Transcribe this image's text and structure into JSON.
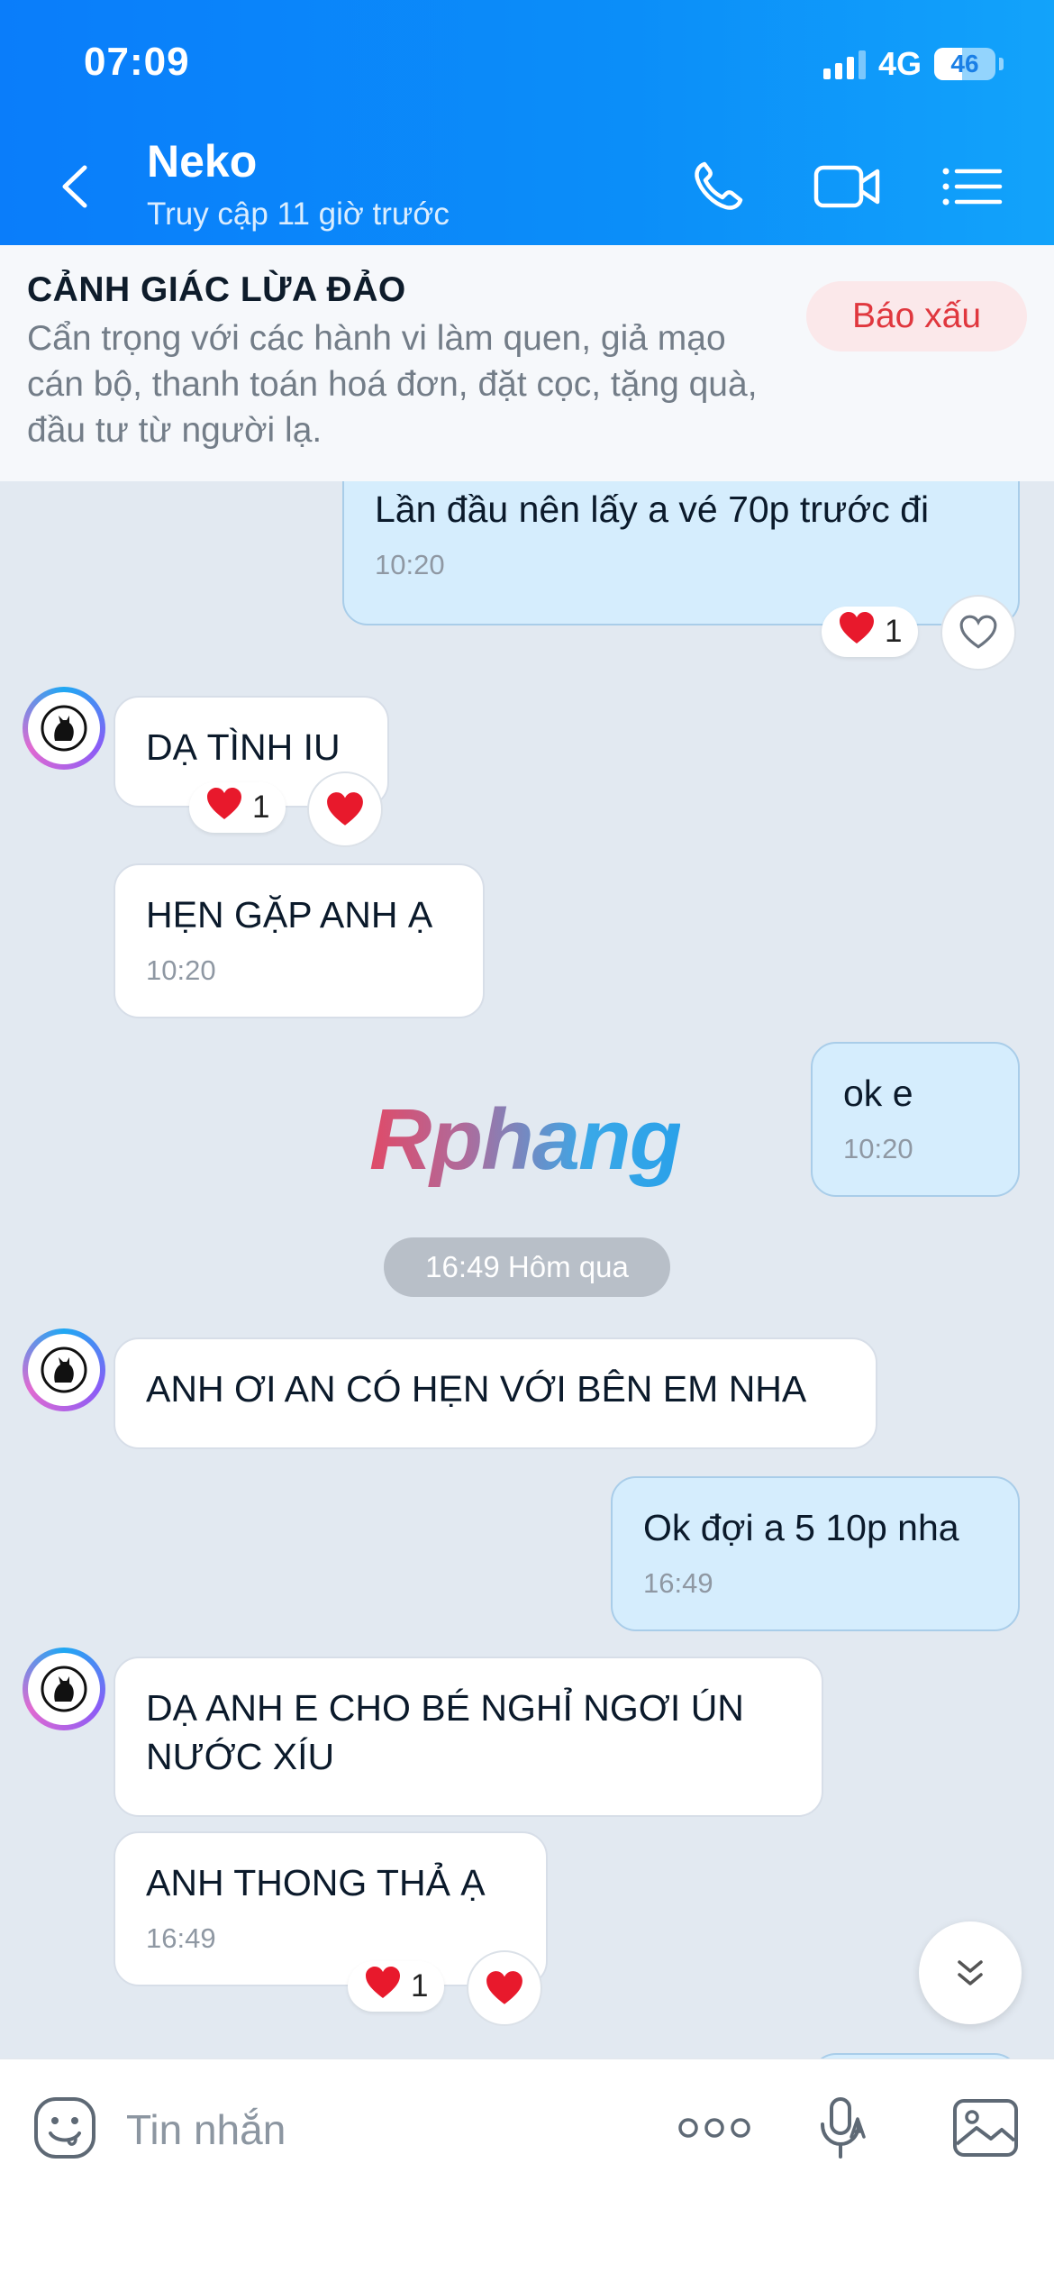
{
  "status_bar": {
    "time": "07:09",
    "network": "4G",
    "battery": "46"
  },
  "header": {
    "contact_name": "Neko",
    "contact_status": "Truy cập 11 giờ trước"
  },
  "warning": {
    "title": "CẢNH GIÁC LỪA ĐẢO",
    "text": "Cẩn trọng với các hành vi làm quen, giả mạo cán bộ, thanh toán hoá đơn, đặt cọc, tặng quà, đầu tư từ người lạ.",
    "report_label": "Báo xấu"
  },
  "messages": [
    {
      "direction": "out",
      "text": "Lần đầu nên lấy a vé 70p trước đi",
      "time": "10:20",
      "reaction_count": "1"
    },
    {
      "direction": "in",
      "text": "DẠ TÌNH IU",
      "reaction_count": "1"
    },
    {
      "direction": "in",
      "text": "HẸN GẶP ANH Ạ",
      "time": "10:20"
    },
    {
      "direction": "out",
      "text": "ok e",
      "time": "10:20"
    },
    {
      "direction": "in",
      "text": "ANH ƠI AN CÓ HẸN VỚI BÊN EM NHA"
    },
    {
      "direction": "out",
      "text": "Ok đợi a 5 10p nha",
      "time": "16:49"
    },
    {
      "direction": "in",
      "text": "DẠ ANH E CHO BÉ NGHỈ NGƠI ÚN NƯỚC XÍU"
    },
    {
      "direction": "in",
      "text": "ANH THONG THẢ Ạ",
      "time": "16:49",
      "reaction_count": "1"
    }
  ],
  "date_divider": "16:49 Hôm qua",
  "watermark": "Rphang",
  "input": {
    "placeholder": "Tin nhắn"
  },
  "colors": {
    "header_blue": "#0a7dfa",
    "bubble_out": "#d5edfd",
    "bubble_in": "#ffffff",
    "chat_bg": "#e2e9f1",
    "report_red": "#e0373e"
  },
  "icons": [
    "back-icon",
    "phone-icon",
    "video-call-icon",
    "menu-list-icon",
    "heart-icon",
    "heart-outline-icon",
    "chevron-double-down-icon",
    "sticker-icon",
    "more-dots-icon",
    "voice-mic-icon",
    "image-icon"
  ]
}
